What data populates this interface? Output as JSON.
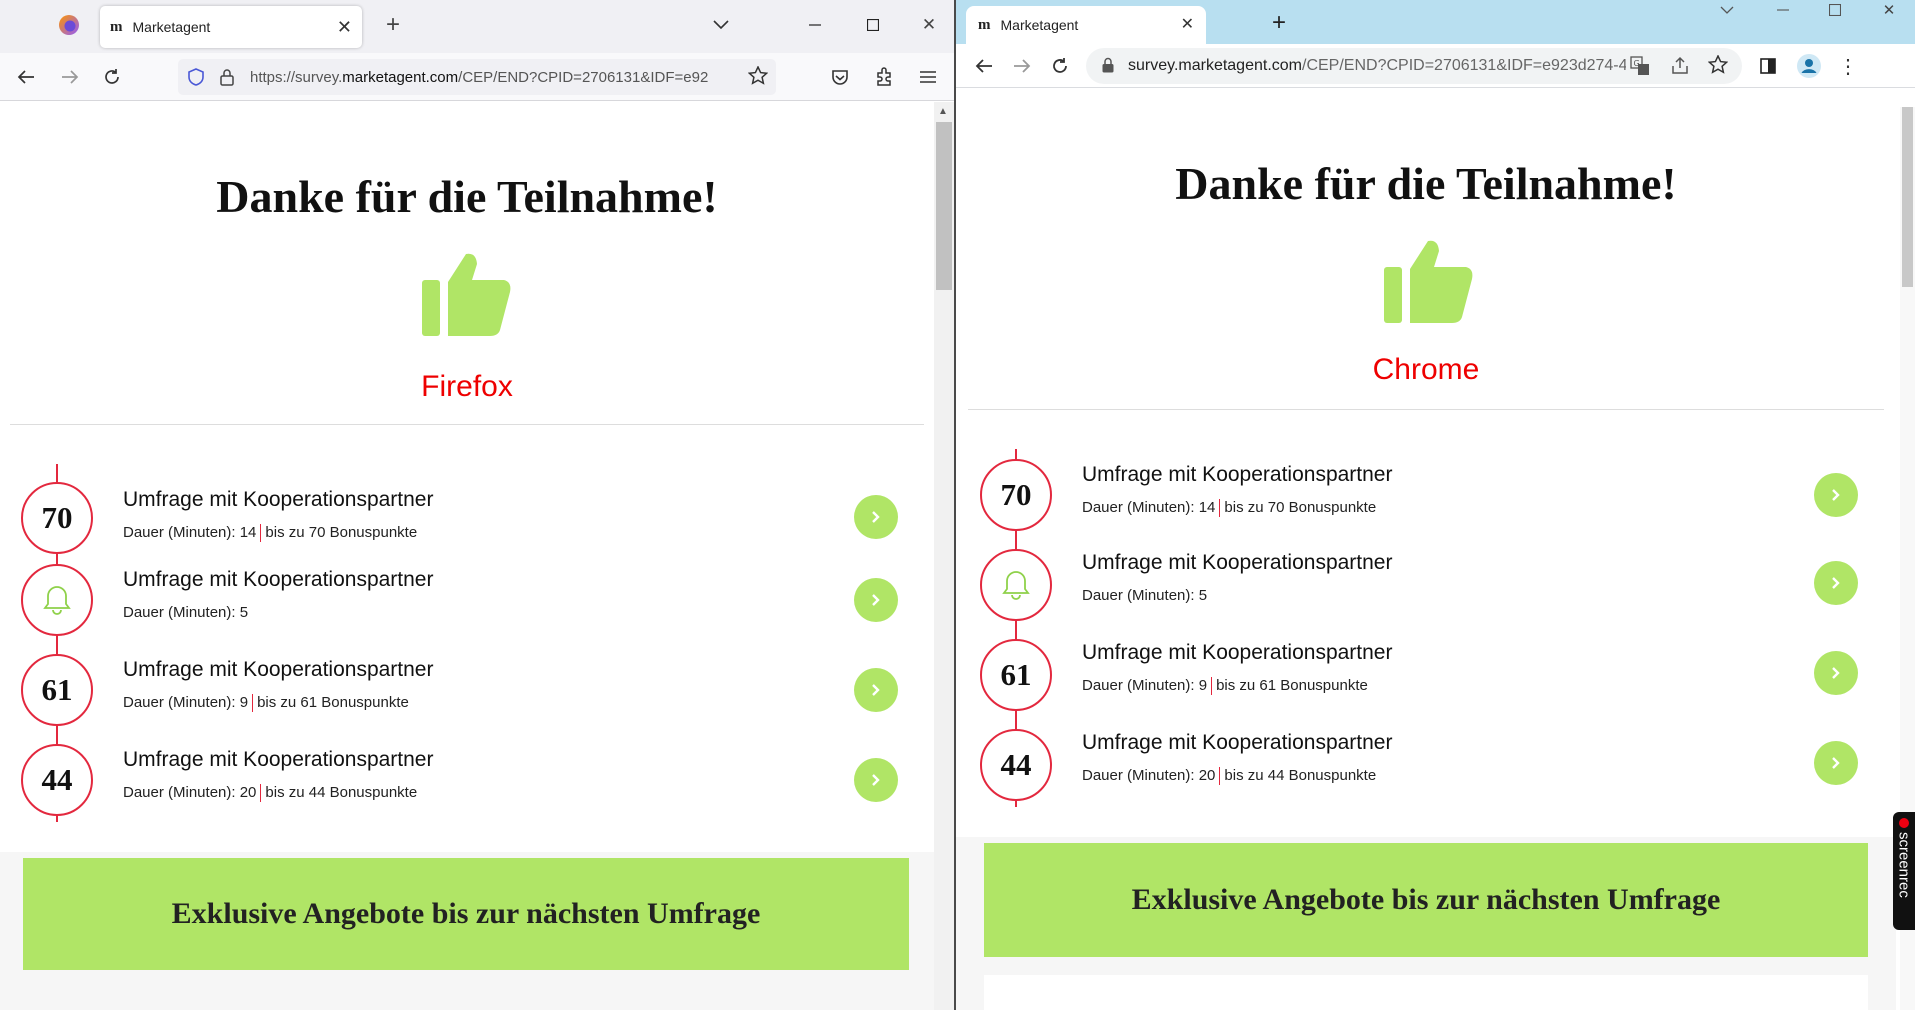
{
  "windows": [
    {
      "id": "firefox",
      "tab_title": "Marketagent",
      "favicon_text": "m",
      "url_prefix": "https://survey.",
      "url_host": "marketagent.com",
      "url_rest": "/CEP/END?CPID=2706131&IDF=e92",
      "heading": "Danke für die Teilnahme!",
      "browser_label": "Firefox",
      "surveys": [
        {
          "badge": "70",
          "title": "Umfrage mit Kooperationspartner",
          "duration": "Dauer (Minuten): 14",
          "points": "bis zu 70 Bonuspunkte"
        },
        {
          "badge": "bell",
          "title": "Umfrage mit Kooperationspartner",
          "duration": "Dauer (Minuten): 5",
          "points": ""
        },
        {
          "badge": "61",
          "title": "Umfrage mit Kooperationspartner",
          "duration": "Dauer (Minuten): 9",
          "points": "bis zu 61 Bonuspunkte"
        },
        {
          "badge": "44",
          "title": "Umfrage mit Kooperationspartner",
          "duration": "Dauer (Minuten): 20",
          "points": "bis zu 44 Bonuspunkte"
        }
      ],
      "banner": "Exklusive Angebote bis zur nächsten Umfrage"
    },
    {
      "id": "chrome",
      "tab_title": "Marketagent",
      "favicon_text": "m",
      "url_prefix": "",
      "url_host": "survey.marketagent.com",
      "url_rest": "/CEP/END?CPID=2706131&IDF=e923d274-41...",
      "heading": "Danke für die Teilnahme!",
      "browser_label": "Chrome",
      "surveys": [
        {
          "badge": "70",
          "title": "Umfrage mit Kooperationspartner",
          "duration": "Dauer (Minuten): 14",
          "points": "bis zu 70 Bonuspunkte"
        },
        {
          "badge": "bell",
          "title": "Umfrage mit Kooperationspartner",
          "duration": "Dauer (Minuten): 5",
          "points": ""
        },
        {
          "badge": "61",
          "title": "Umfrage mit Kooperationspartner",
          "duration": "Dauer (Minuten): 9",
          "points": "bis zu 61 Bonuspunkte"
        },
        {
          "badge": "44",
          "title": "Umfrage mit Kooperationspartner",
          "duration": "Dauer (Minuten): 20",
          "points": "bis zu 44 Bonuspunkte"
        }
      ],
      "banner": "Exklusive Angebote bis zur nächsten Umfrage"
    }
  ],
  "screenrec_label": "screenrec",
  "colors": {
    "accent_green": "#b0e566",
    "accent_red": "#e3283e",
    "label_red": "#e00000"
  }
}
